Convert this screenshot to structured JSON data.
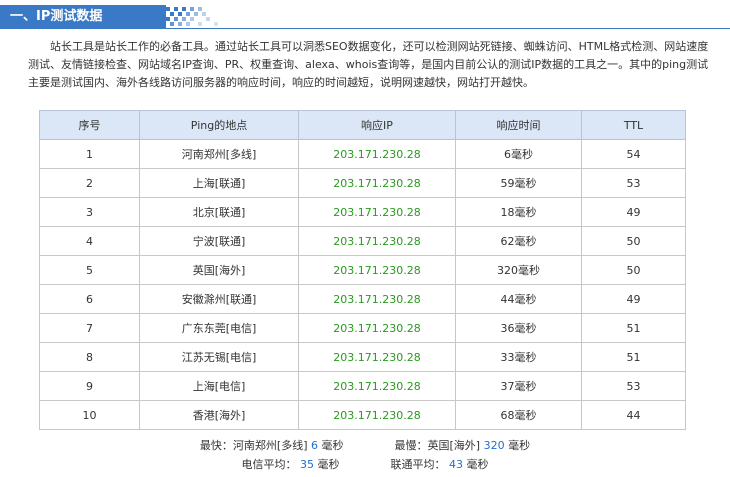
{
  "section": {
    "title": "一、IP测试数据"
  },
  "intro": "站长工具是站长工作的必备工具。通过站长工具可以洞悉SEO数据变化，还可以检测网站死链接、蜘蛛访问、HTML格式检测、网站速度测试、友情链接检查、网站域名IP查询、PR、权重查询、alexa、whois查询等，是国内目前公认的测试IP数据的工具之一。其中的ping测试主要是测试国内、海外各线路访问服务器的响应时间，响应的时间越短，说明网速越快，网站打开越快。",
  "table": {
    "headers": [
      "序号",
      "Ping的地点",
      "响应IP",
      "响应时间",
      "TTL"
    ],
    "rows": [
      {
        "no": "1",
        "location": "河南郑州[多线]",
        "ip": "203.171.230.28",
        "time": "6毫秒",
        "ttl": "54"
      },
      {
        "no": "2",
        "location": "上海[联通]",
        "ip": "203.171.230.28",
        "time": "59毫秒",
        "ttl": "53"
      },
      {
        "no": "3",
        "location": "北京[联通]",
        "ip": "203.171.230.28",
        "time": "18毫秒",
        "ttl": "49"
      },
      {
        "no": "4",
        "location": "宁波[联通]",
        "ip": "203.171.230.28",
        "time": "62毫秒",
        "ttl": "50"
      },
      {
        "no": "5",
        "location": "英国[海外]",
        "ip": "203.171.230.28",
        "time": "320毫秒",
        "ttl": "50"
      },
      {
        "no": "6",
        "location": "安徽滁州[联通]",
        "ip": "203.171.230.28",
        "time": "44毫秒",
        "ttl": "49"
      },
      {
        "no": "7",
        "location": "广东东莞[电信]",
        "ip": "203.171.230.28",
        "time": "36毫秒",
        "ttl": "51"
      },
      {
        "no": "8",
        "location": "江苏无锡[电信]",
        "ip": "203.171.230.28",
        "time": "33毫秒",
        "ttl": "51"
      },
      {
        "no": "9",
        "location": "上海[电信]",
        "ip": "203.171.230.28",
        "time": "37毫秒",
        "ttl": "53"
      },
      {
        "no": "10",
        "location": "香港[海外]",
        "ip": "203.171.230.28",
        "time": "68毫秒",
        "ttl": "44"
      }
    ]
  },
  "summary": {
    "fastest_label": "最快：河南郑州[多线]",
    "fastest_value": "6",
    "slowest_label": "最慢：英国[海外]",
    "slowest_value": "320",
    "unit": "毫秒",
    "telecom_label": "电信平均：",
    "telecom_value": "35",
    "unicom_label": "联通平均：",
    "unicom_value": "43"
  },
  "colors": {
    "accent": "#3a79c6",
    "ip": "#2a9a1f",
    "number": "#1f6fd0",
    "header_bg": "#dbe7f6"
  }
}
